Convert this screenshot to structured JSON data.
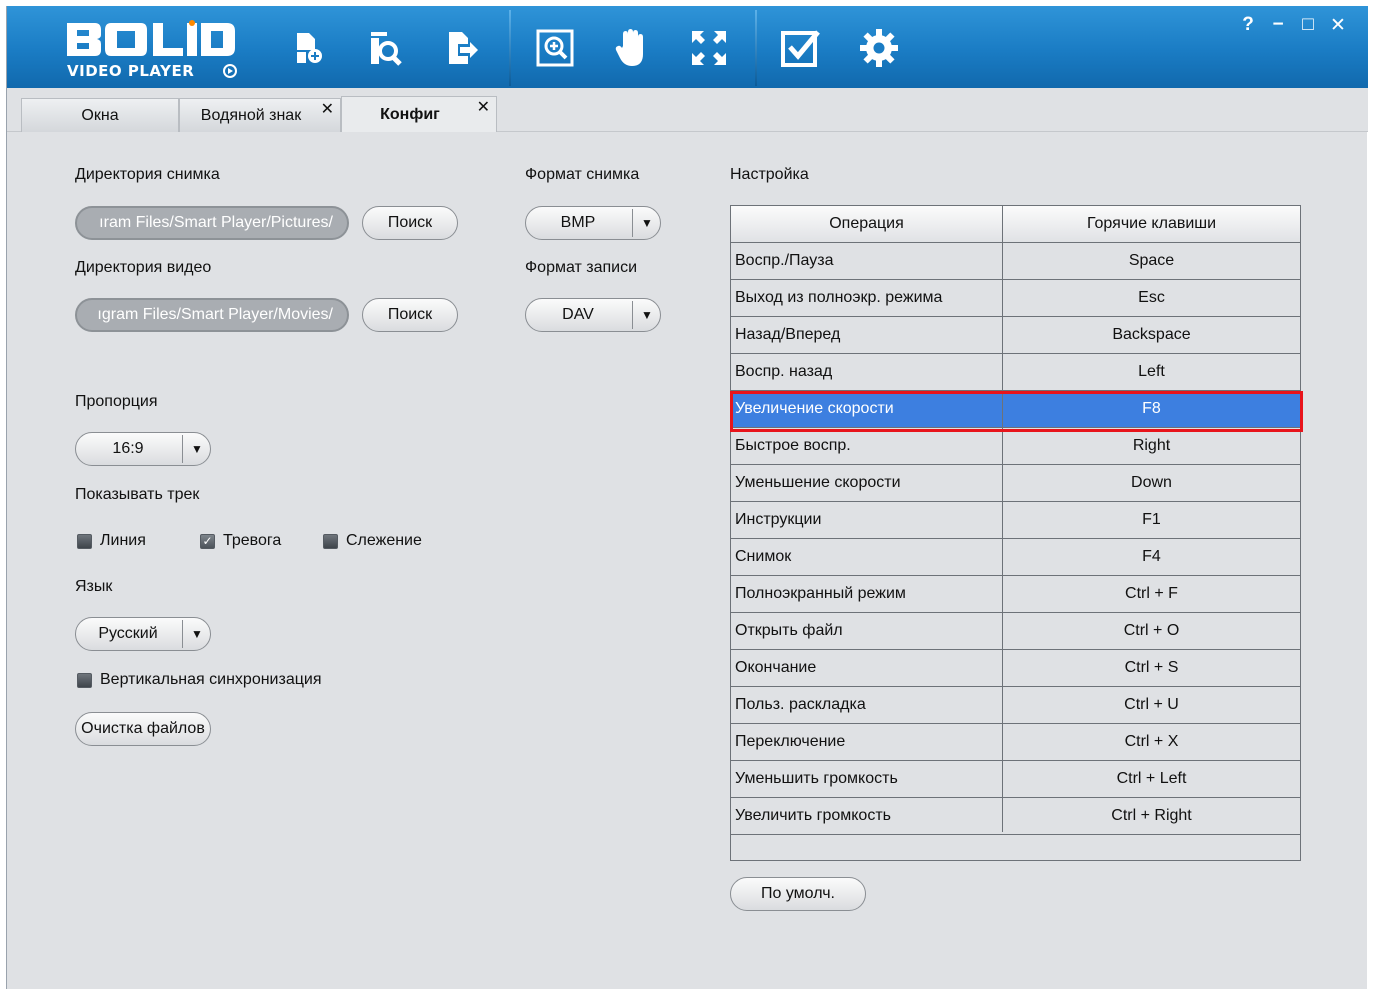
{
  "app": {
    "logo_word": "BOLID",
    "logo_sub": "VIDEO PLAYER",
    "window_controls": [
      "?",
      "−",
      "□",
      "✕"
    ]
  },
  "toolbar": {
    "icons": [
      "open-file-icon",
      "search-file-icon",
      "export-icon",
      "zoom-icon",
      "hand-icon",
      "fullscreen-icon",
      "checklist-icon",
      "settings-icon"
    ]
  },
  "tabs": [
    {
      "label": "Окна",
      "closable": false
    },
    {
      "label": "Водяной знак",
      "closable": true
    },
    {
      "label": "Конфиг",
      "closable": true,
      "active": true
    }
  ],
  "left": {
    "snapshot_dir_label": "Директория снимка",
    "snapshot_dir_value": "ıram Files/Smart Player/Pictures/",
    "snapshot_search": "Поиск",
    "video_dir_label": "Директория видео",
    "video_dir_value": "ıgram Files/Smart Player/Movies/",
    "video_search": "Поиск",
    "ratio_label": "Пропорция",
    "ratio_value": "16:9",
    "track_label": "Показывать трек",
    "chk_line": "Линия",
    "chk_alarm": "Тревога",
    "chk_tracking": "Слежение",
    "lang_label": "Язык",
    "lang_value": "Русский",
    "vsync_label": "Вертикальная синхронизация",
    "clear_files": "Очистка файлов"
  },
  "checkbox_states": {
    "line": false,
    "alarm": true,
    "tracking": false,
    "vsync": false
  },
  "middle": {
    "snapshot_format_label": "Формат снимка",
    "snapshot_format_value": "BMP",
    "record_format_label": "Формат записи",
    "record_format_value": "DAV"
  },
  "right": {
    "settings_label": "Настройка",
    "col_operation": "Операция",
    "col_hotkeys": "Горячие клавиши",
    "default_button": "По умолч.",
    "rows": [
      {
        "op": "Воспр./Пауза",
        "key": "Space"
      },
      {
        "op": "Выход из полноэкр. режима",
        "key": "Esc"
      },
      {
        "op": "Назад/Вперед",
        "key": "Backspace"
      },
      {
        "op": "Воспр. назад",
        "key": "Left"
      },
      {
        "op": "Увеличение скорости",
        "key": "F8"
      },
      {
        "op": "Быстрое воспр.",
        "key": "Right"
      },
      {
        "op": "Уменьшение скорости",
        "key": "Down"
      },
      {
        "op": "Инструкции",
        "key": "F1"
      },
      {
        "op": "Снимок",
        "key": "F4"
      },
      {
        "op": "Полноэкранный режим",
        "key": "Ctrl + F"
      },
      {
        "op": "Открыть файл",
        "key": "Ctrl + O"
      },
      {
        "op": "Окончание",
        "key": "Ctrl + S"
      },
      {
        "op": "Польз. раскладка",
        "key": "Ctrl + U"
      },
      {
        "op": "Переключение",
        "key": "Ctrl + X"
      },
      {
        "op": "Уменьшить громкость",
        "key": "Ctrl + Left"
      },
      {
        "op": "Увеличить громкость",
        "key": "Ctrl + Right"
      }
    ],
    "selected_row": 4
  },
  "colors": {
    "titlebar": "#1a7cc4",
    "selection": "#3d7fe0",
    "highlight_box": "#e8141b",
    "panel": "#dfe1e4"
  }
}
